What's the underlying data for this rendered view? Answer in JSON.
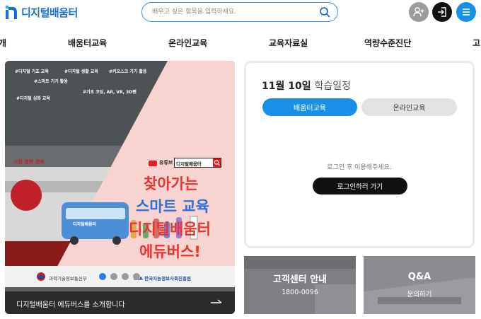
{
  "header": {
    "logo_text": "디지털배움터",
    "search_placeholder": "배우고 싶은 항목을 입력하세요.",
    "search_value": "",
    "icons": {
      "search": "search-icon",
      "join": "user-plus-icon",
      "login": "login-icon",
      "menu": "hamburger-menu-icon"
    },
    "colors": {
      "brand": "#1a6fd6",
      "accent": "#1a8fe8"
    }
  },
  "nav": {
    "items": [
      {
        "label": "개"
      },
      {
        "label": "배움터교육"
      },
      {
        "label": "온라인교육"
      },
      {
        "label": "교육자료실"
      },
      {
        "label": "역량수준진단"
      },
      {
        "label": "고"
      }
    ]
  },
  "banner": {
    "tags": [
      "#디지털 기초 교육",
      "#디지털 생활 교육",
      "#키오스크 기기 활용",
      "#스마트 기기 활용",
      "#기초 코딩, AR, VR, 3D펜",
      "#디지털 심화 교육"
    ],
    "youtube_label": "유튜브",
    "youtube_search": "디지털배움터",
    "headline": [
      "찾아가는",
      "스마트 교육",
      "디지털배움터",
      "에듀버스!"
    ],
    "bus_text": "디지털배움터",
    "side_text": "사랑 행복 경북",
    "org1": "과학기술정보통신부",
    "org2": "NIA 한국지능정보사회진흥원",
    "caption": "디지털배움터 에듀버스를 소개합니다",
    "slides_total": 4,
    "slide_active": 1
  },
  "schedule": {
    "title_date": "11월 10일",
    "title_suffix": "학습일정",
    "tabs": [
      {
        "label": "배움터교육",
        "active": true
      },
      {
        "label": "온라인교육",
        "active": false
      }
    ],
    "notice": "로그인 후 이용해주세요.",
    "login_button": "로그인하러 가기"
  },
  "tiles": [
    {
      "title": "고객센터 안내",
      "sub": "1800-0096"
    },
    {
      "title": "Q&A",
      "sub": "문의하기"
    }
  ]
}
